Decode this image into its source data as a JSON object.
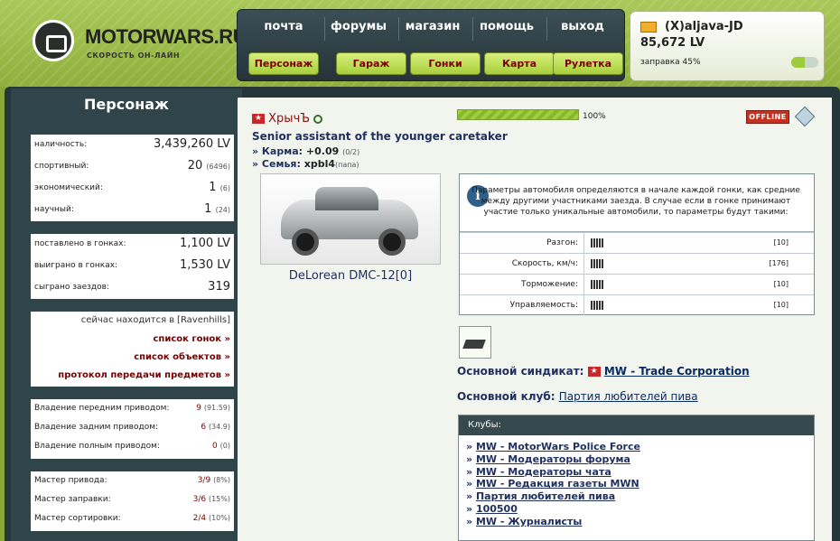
{
  "site": {
    "name": "MOTORWARS.RU",
    "slogan": "СКОРОСТЬ ОН-ЛАЙН"
  },
  "nav": {
    "top": [
      "почта",
      "форумы",
      "магазин",
      "помощь",
      "выход"
    ],
    "buttons": [
      "Персонаж",
      "Гараж",
      "Гонки",
      "Карта",
      "Рулетка"
    ]
  },
  "user": {
    "name": "(X)aljava-JD",
    "money": "85,672 LV",
    "fuel": "заправка 45%"
  },
  "sidebar": {
    "title": "Персонаж",
    "stats": [
      {
        "label": "наличность:",
        "value": "3,439,260 LV",
        "sub": ""
      },
      {
        "label": "спортивный:",
        "value": "20",
        "sub": "(6496)"
      },
      {
        "label": "экономический:",
        "value": "1",
        "sub": "(6)"
      },
      {
        "label": "научный:",
        "value": "1",
        "sub": "(24)"
      }
    ],
    "races": [
      {
        "label": "поставлено в гонках:",
        "value": "1,100 LV"
      },
      {
        "label": "выиграно в гонках:",
        "value": "1,530 LV"
      },
      {
        "label": "сыграно заездов:",
        "value": "319"
      }
    ],
    "location_prefix": "сейчас находится в",
    "location": "[Ravenhills]",
    "links": [
      "список гонок »",
      "список объектов »",
      "протокол передачи предметов »"
    ],
    "drive": [
      {
        "label": "Владение передним приводом:",
        "value": "9",
        "sub": "(91.59)"
      },
      {
        "label": "Владение задним приводом:",
        "value": "6",
        "sub": "(34.9)"
      },
      {
        "label": "Владение полным приводом:",
        "value": "0",
        "sub": "(0)"
      }
    ],
    "masters": [
      {
        "label": "Мастер привода:",
        "value": "3/9",
        "sub": "(8%)"
      },
      {
        "label": "Мастер заправки:",
        "value": "3/6",
        "sub": "(15%)"
      },
      {
        "label": "Мастер сортировки:",
        "value": "2/4",
        "sub": "(10%)"
      }
    ]
  },
  "profile": {
    "name": "ХрычЪ",
    "rank": "Senior assistant of the younger caretaker",
    "karma_label": "» Карма:",
    "karma_value": "+0.09",
    "karma_sub": "(0/2)",
    "family_label": "» Семья:",
    "family_value": "xpbl4",
    "family_sub": "(папа)",
    "progress_pct": 100,
    "progress_text": "100%",
    "status": "OFFLINE",
    "car_name": "DeLorean DMC-12[0]"
  },
  "params": {
    "info": "Параметры автомобиля определяются в начале каждой гонки, как средние между другими участниками заезда. В случае если в гонке принимают участие только уникальные автомобили, то параметры будут такими:",
    "rows": [
      {
        "label": "Разгон:",
        "value": "[10]"
      },
      {
        "label": "Скорость, км/ч:",
        "value": "[176]"
      },
      {
        "label": "Торможение:",
        "value": "[10]"
      },
      {
        "label": "Управляемость:",
        "value": "[10]"
      }
    ]
  },
  "syndicate": {
    "label": "Основной синдикат:",
    "value": "MW - Trade Corporation"
  },
  "club": {
    "label": "Основной клуб:",
    "value": "Партия любителей пива"
  },
  "clubs": {
    "title": "Клубы:",
    "items": [
      "MW - MotorWars Police Force",
      "MW - Модераторы форума",
      "MW - Модераторы чата",
      "MW - Редакция газеты MWN",
      "Партия любителей пива",
      "100500",
      "MW - Журналисты"
    ]
  }
}
